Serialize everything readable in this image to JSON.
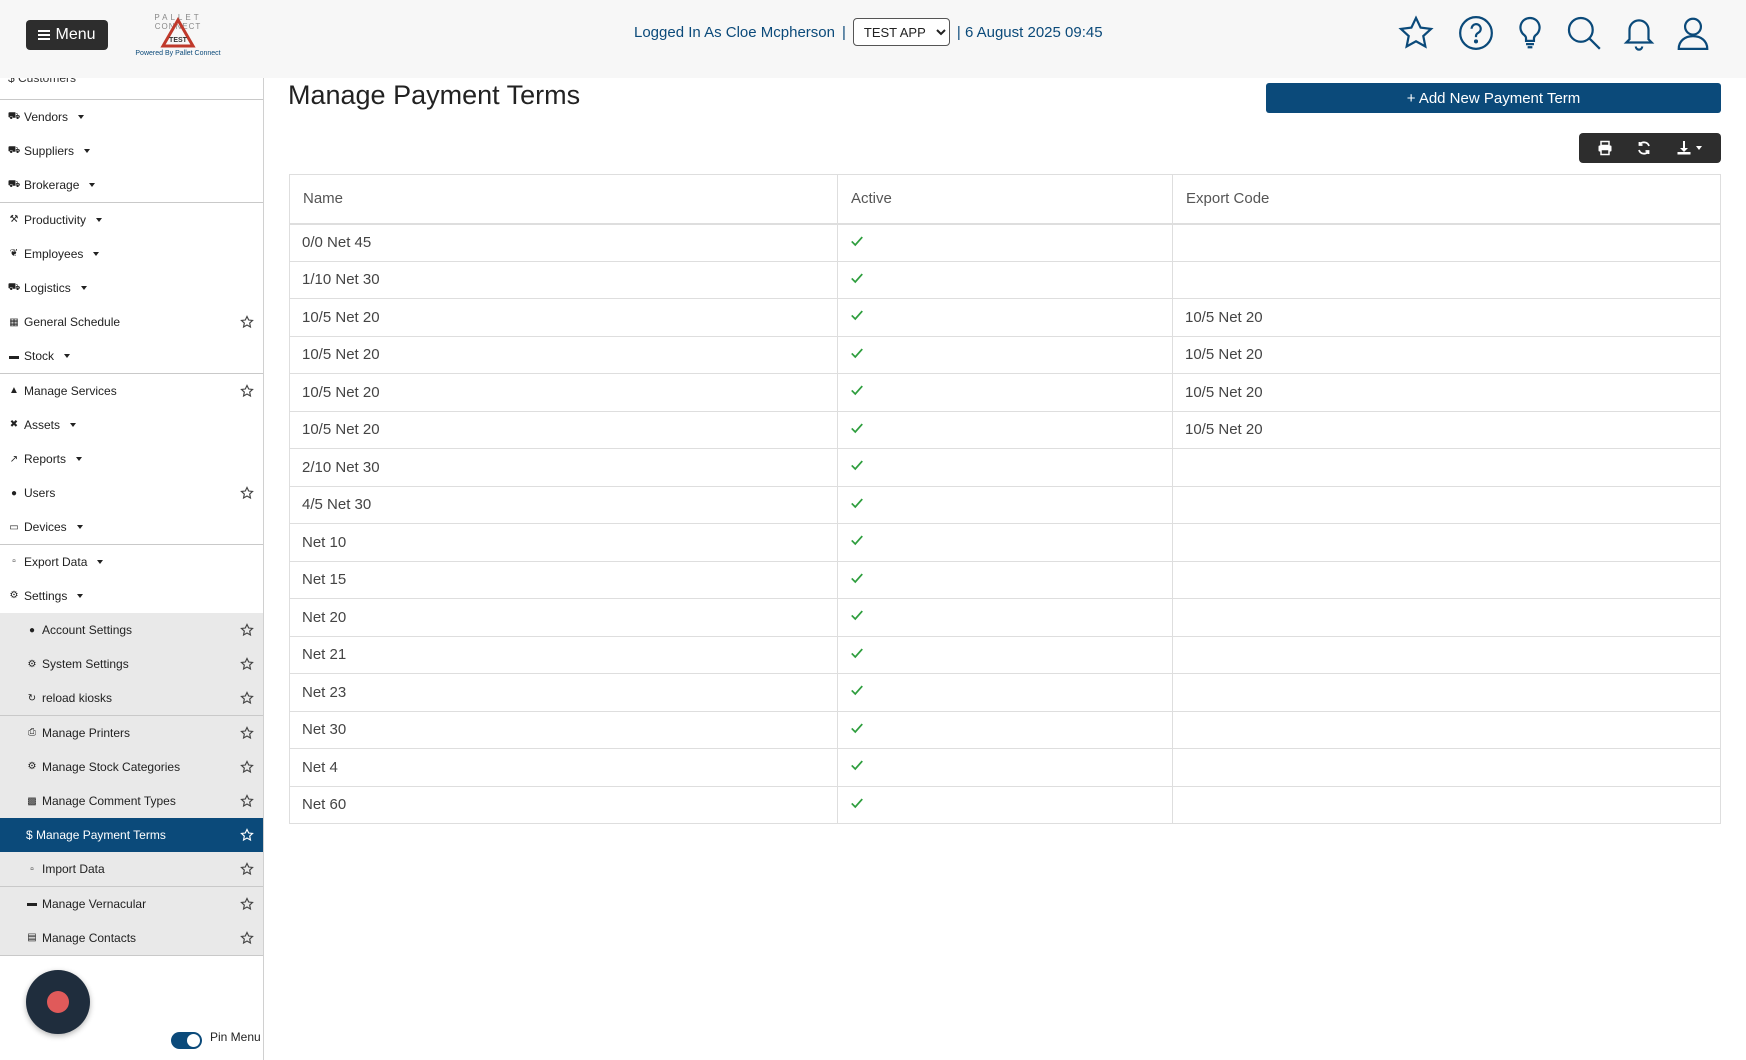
{
  "header": {
    "menu_label": "Menu",
    "logo_text": "PALLET CONNECT TEST",
    "logo_tagline": "Powered By Pallet Connect",
    "logged_in_label": "Logged In As Cloe Mcpherson",
    "separator": "|",
    "app_selected": "TEST APP",
    "date_label": "| 6 August 2025 09:45",
    "icons": [
      "star-icon",
      "help-icon",
      "lightbulb-icon",
      "search-icon",
      "bell-icon",
      "user-icon"
    ],
    "accent_color": "#0b4a7a"
  },
  "sidebar": {
    "partial_item": "$ Customers",
    "items": [
      {
        "label": "Vendors",
        "icon": "truck-icon",
        "dropdown": true
      },
      {
        "label": "Suppliers",
        "icon": "truck-icon",
        "dropdown": true
      },
      {
        "label": "Brokerage",
        "icon": "truck-icon",
        "dropdown": true
      },
      {
        "label": "Productivity",
        "icon": "hammer-icon",
        "dropdown": true
      },
      {
        "label": "Employees",
        "icon": "person-icon",
        "dropdown": true
      },
      {
        "label": "Logistics",
        "icon": "truck-icon",
        "dropdown": true
      },
      {
        "label": "General Schedule",
        "icon": "calendar-icon",
        "star": true
      },
      {
        "label": "Stock",
        "icon": "pallet-icon",
        "dropdown": true
      },
      {
        "label": "Manage Services",
        "icon": "service-icon",
        "star": true
      },
      {
        "label": "Assets",
        "icon": "tools-icon",
        "dropdown": true
      },
      {
        "label": "Reports",
        "icon": "chart-icon",
        "dropdown": true
      },
      {
        "label": "Users",
        "icon": "users-icon",
        "star": true
      },
      {
        "label": "Devices",
        "icon": "monitor-icon",
        "dropdown": true
      },
      {
        "label": "Export Data",
        "icon": "export-icon",
        "dropdown": true
      },
      {
        "label": "Settings",
        "icon": "gears-icon",
        "dropdown": true
      },
      {
        "label": "Account Settings",
        "icon": "user-icon",
        "star": true,
        "sub": true
      },
      {
        "label": "System Settings",
        "icon": "gears-icon",
        "star": true,
        "sub": true
      },
      {
        "label": "reload kiosks",
        "icon": "refresh-icon",
        "star": true,
        "sub": true
      },
      {
        "label": "Manage Printers",
        "icon": "printer-icon",
        "star": true,
        "sub": true
      },
      {
        "label": "Manage Stock Categories",
        "icon": "gears-icon",
        "star": true,
        "sub": true
      },
      {
        "label": "Manage Comment Types",
        "icon": "comments-icon",
        "star": true,
        "sub": true
      },
      {
        "label": "$ Manage Payment Terms",
        "icon": "dollar-icon",
        "star": true,
        "sub": true,
        "active": true
      },
      {
        "label": "Import Data",
        "icon": "import-icon",
        "star": true,
        "sub": true
      },
      {
        "label": "Manage Vernacular",
        "icon": "idcard-icon",
        "star": true,
        "sub": true
      },
      {
        "label": "Manage Contacts",
        "icon": "contacts-icon",
        "star": true,
        "sub": true
      }
    ],
    "pin_label": "Pin Menu",
    "pin_on": true
  },
  "main": {
    "title": "Manage Payment Terms",
    "add_button_label": "+ Add New Payment Term",
    "toolbar_icons": [
      "print-icon",
      "refresh-icon",
      "download-icon"
    ],
    "columns": [
      "Name",
      "Active",
      "Export Code"
    ],
    "rows": [
      {
        "name": "0/0 Net 45",
        "active": true,
        "export_code": ""
      },
      {
        "name": "1/10 Net 30",
        "active": true,
        "export_code": ""
      },
      {
        "name": "10/5 Net 20",
        "active": true,
        "export_code": "10/5 Net 20"
      },
      {
        "name": "10/5 Net 20",
        "active": true,
        "export_code": "10/5 Net 20"
      },
      {
        "name": "10/5 Net 20",
        "active": true,
        "export_code": "10/5 Net 20"
      },
      {
        "name": "10/5 Net 20",
        "active": true,
        "export_code": "10/5 Net 20"
      },
      {
        "name": "2/10 Net 30",
        "active": true,
        "export_code": ""
      },
      {
        "name": "4/5 Net 30",
        "active": true,
        "export_code": ""
      },
      {
        "name": "Net 10",
        "active": true,
        "export_code": ""
      },
      {
        "name": "Net 15",
        "active": true,
        "export_code": ""
      },
      {
        "name": "Net 20",
        "active": true,
        "export_code": ""
      },
      {
        "name": "Net 21",
        "active": true,
        "export_code": ""
      },
      {
        "name": "Net 23",
        "active": true,
        "export_code": ""
      },
      {
        "name": "Net 30",
        "active": true,
        "export_code": ""
      },
      {
        "name": "Net 4",
        "active": true,
        "export_code": ""
      },
      {
        "name": "Net 60",
        "active": true,
        "export_code": ""
      }
    ],
    "check_color": "#2e9e3e"
  }
}
